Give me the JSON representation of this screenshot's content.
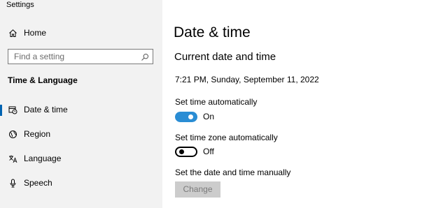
{
  "app": {
    "title": "Settings"
  },
  "sidebar": {
    "home_label": "Home",
    "search": {
      "placeholder": "Find a setting"
    },
    "section_header": "Time & Language",
    "items": [
      {
        "label": "Date & time",
        "icon": "calendar-clock-icon",
        "active": true
      },
      {
        "label": "Region",
        "icon": "globe-icon",
        "active": false
      },
      {
        "label": "Language",
        "icon": "language-icon",
        "active": false
      },
      {
        "label": "Speech",
        "icon": "microphone-icon",
        "active": false
      }
    ],
    "accent_color": "#0063b1"
  },
  "main": {
    "title": "Date & time",
    "subtitle": "Current date and time",
    "current_datetime": "7:21 PM, Sunday, September 11, 2022",
    "set_time_auto": {
      "label": "Set time automatically",
      "state": "On",
      "enabled": true
    },
    "set_timezone_auto": {
      "label": "Set time zone automatically",
      "state": "Off",
      "enabled": false
    },
    "manual": {
      "label": "Set the date and time manually",
      "button": "Change"
    },
    "toggle_on_color": "#2a8dd4"
  }
}
